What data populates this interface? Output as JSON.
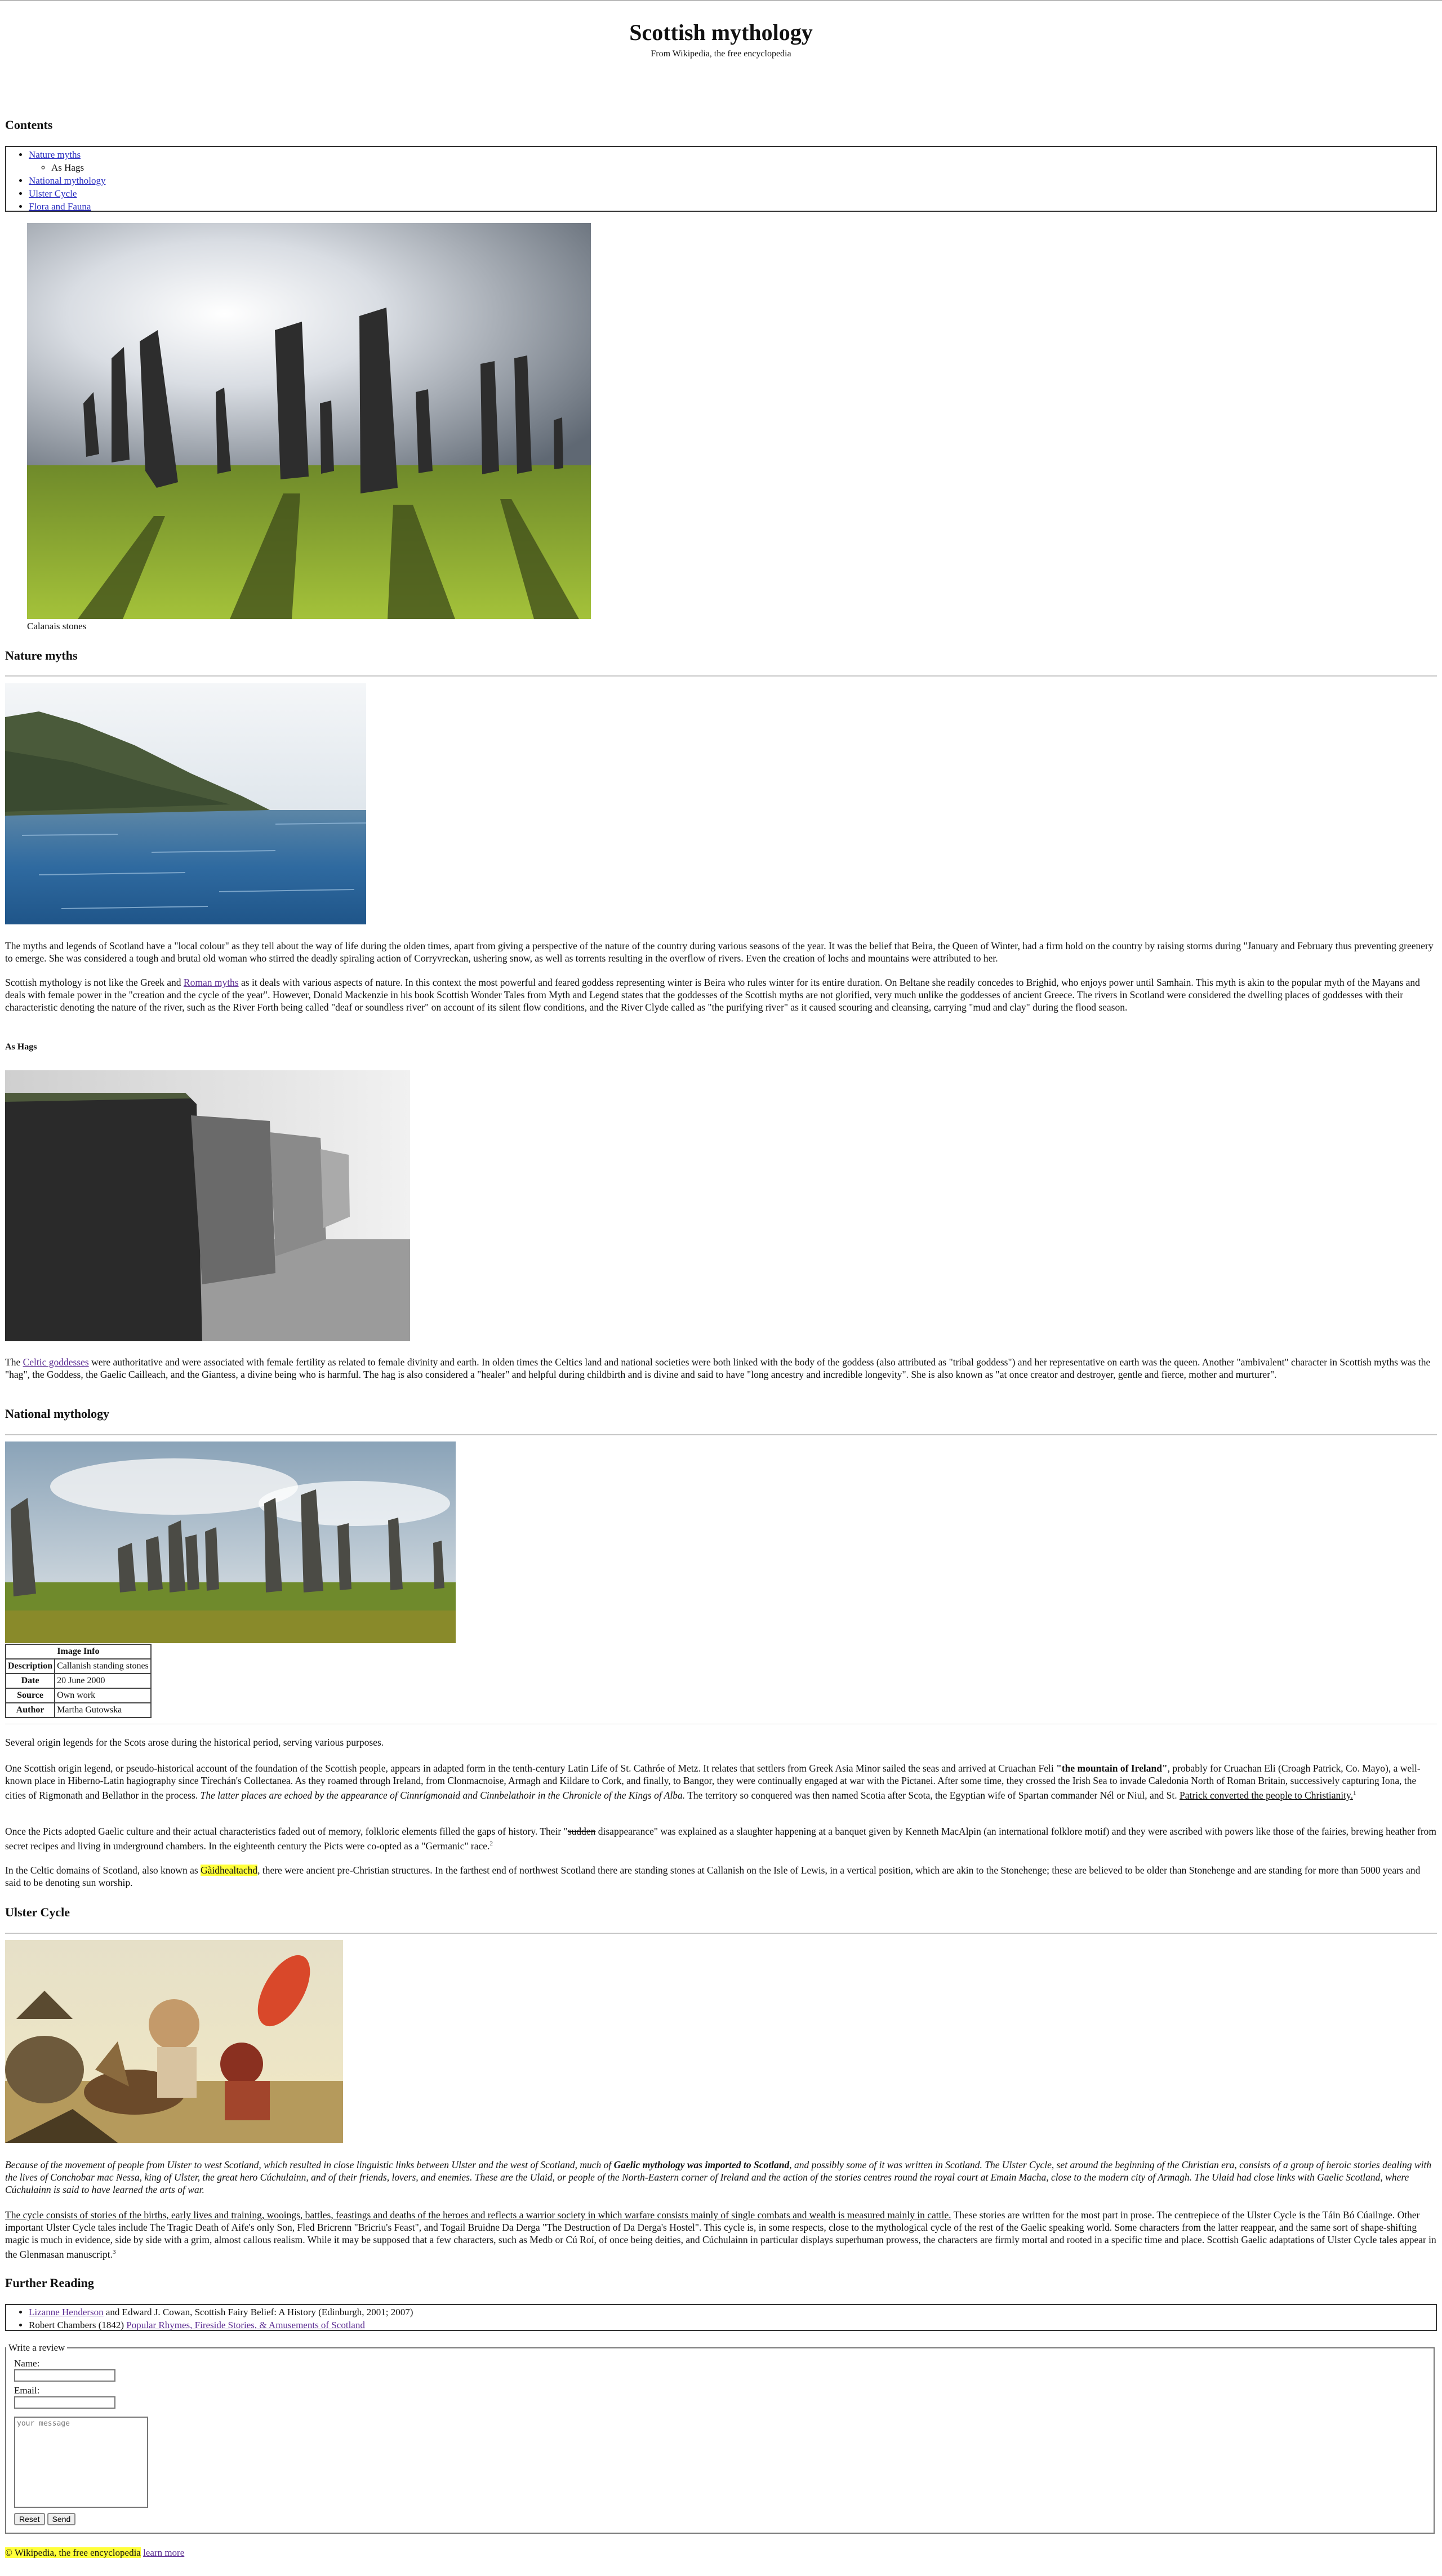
{
  "header": {
    "title": "Scottish mythology",
    "subtitle": "From Wikipedia, the free encyclopedia"
  },
  "contents": {
    "heading": "Contents",
    "items": [
      "Nature myths",
      "As Hags",
      "National mythology",
      "Ulster Cycle",
      "Flora and Fauna"
    ]
  },
  "figure_callanais": {
    "caption": "Calanais stones"
  },
  "nature_myths": {
    "heading": "Nature myths",
    "p1": "The myths and legends of Scotland have a \"local colour\" as they tell about the way of life during the olden times, apart from giving a perspective of the nature of the country during various seasons of the year. It was the belief that Beira, the Queen of Winter, had a firm hold on the country by raising storms during \"January and February thus preventing greenery to emerge. She was considered a tough and brutal old woman who stirred the deadly spiraling action of Corryvreckan, ushering snow, as well as torrents resulting in the overflow of rivers. Even the creation of lochs and mountains were attributed to her.",
    "p2_a": "Scottish mythology is not like the Greek and ",
    "p2_link": "Roman myths",
    "p2_b": " as it deals with various aspects of nature. In this context the most powerful and feared goddess representing winter is Beira who rules winter for its entire duration. On Beltane she readily concedes to Brighid, who enjoys power until Samhain. This myth is akin to the popular myth of the Mayans and deals with female power in the \"creation and the cycle of the year\". However, Donald Mackenzie in his book Scottish Wonder Tales from Myth and Legend states that the goddesses of the Scottish myths are not glorified, very much unlike the goddesses of ancient Greece. The rivers in Scotland were considered the dwelling places of goddesses with their characteristic denoting the nature of the river, such as the River Forth being called \"deaf or soundless river\" on account of its silent flow conditions, and the River Clyde called as \"the purifying river\" as it caused scouring and cleansing, carrying \"mud and clay\" during the flood season."
  },
  "as_hags": {
    "heading": "As Hags",
    "p_a": "The ",
    "p_link": "Celtic goddesses",
    "p_b": " were authoritative and were associated with female fertility as related to female divinity and earth. In olden times the Celtics land and national societies were both linked with the body of the goddess (also attributed as \"tribal goddess\") and her representative on earth was the queen. Another \"ambivalent\" character in Scottish myths was the \"hag\", the Goddess, the Gaelic Cailleach, and the Giantess, a divine being who is harmful. The hag is also considered a \"healer\" and helpful during childbirth and is divine and said to have \"long ancestry and incredible longevity\". She is also known as \"at once creator and destroyer, gentle and fierce, mother and murturer\"."
  },
  "national": {
    "heading": "National mythology",
    "table_caption": "Image Info",
    "rows": [
      {
        "label": "Description",
        "value": "Callanish standing stones"
      },
      {
        "label": "Date",
        "value": "20 June 2000"
      },
      {
        "label": "Source",
        "value": "Own work"
      },
      {
        "label": "Author",
        "value": "Martha Gutowska"
      }
    ],
    "intro": "Several origin legends for the Scots arose during the historical period, serving various purposes.",
    "p1_a": "One Scottish origin legend, or pseudo-historical account of the foundation of the Scottish people, appears in adapted form in the tenth-century Latin Life of St. Cathróe of Metz. It relates that settlers from Greek Asia Minor sailed the seas and arrived at Cruachan Feli ",
    "p1_bold": "\"the mountain of Ireland\"",
    "p1_b": ", probably for Cruachan Eli (Croagh Patrick, Co. Mayo), a well-known place in Hiberno-Latin hagiography since Tírechán's Collectanea. As they roamed through Ireland, from Clonmacnoise, Armagh and Kildare to Cork, and finally, to Bangor, they were continually engaged at war with the Pictanei. After some time, they crossed the Irish Sea to invade Caledonia North of Roman Britain, successively capturing Iona, the cities of Rigmonath and Bellathor in the process. ",
    "p1_italic": "The latter places are echoed by the appearance of Cinnrígmonaid and Cinnbelathoir in the Chronicle of the Kings of Alba.",
    "p1_c": " The territory so conquered was then named Scotia after Scota, the Egyptian wife of Spartan commander Nél or Niul, and St. ",
    "p1_underline": "Patrick converted the people to Christianity.",
    "p1_sup": "1",
    "p2_a": "Once the Picts adopted Gaelic culture and their actual characteristics faded out of memory, folkloric elements filled the gaps of history. Their \"",
    "p2_strike": "sudden",
    "p2_b": " disappearance\" was explained as a slaughter happening at a banquet given by Kenneth MacAlpin (an international folklore motif) and they were ascribed with powers like those of the fairies, brewing heather from secret recipes and living in underground chambers. In the eighteenth century the Picts were co-opted as a \"Germanic\" race.",
    "p2_sup": "2",
    "p3_a": "In the Celtic domains of Scotland, also known as ",
    "p3_hl": "Gàidhealtachd",
    "p3_b": ", there were ancient pre-Christian structures. In the farthest end of northwest Scotland there are standing stones at Callanish on the Isle of Lewis, in a vertical position, which are akin to the Stonehenge; these are believed to be older than Stonehenge and are standing for more than 5000 years and said to be denoting sun worship."
  },
  "ulster": {
    "heading": "Ulster Cycle",
    "p1_a": "Because of the movement of people from Ulster to west Scotland, which resulted in close linguistic links between Ulster and the west of Scotland, much of ",
    "p1_bold": "Gaelic mythology was imported to Scotland",
    "p1_b": ", and possibly some of it was written in Scotland. The Ulster Cycle, set around the beginning of the Christian era, consists of a group of heroic stories dealing with the lives of Conchobar mac Nessa, king of Ulster, the great hero Cúchulainn, and of their friends, lovers, and enemies. These are the Ulaid, or people of the North-Eastern corner of Ireland and the action of the stories centres round the royal court at Emain Macha, close to the modern city of Armagh. The Ulaid had close links with Gaelic Scotland, where Cúchulainn is said to have learned the arts of war.",
    "p2_underline": "The cycle consists of stories of the births, early lives and training, wooings, battles, feastings and deaths of the heroes and reflects a warrior society in which warfare consists mainly of single combats and wealth is measured mainly in cattle.",
    "p2_b": " These stories are written for the most part in prose. The centrepiece of the Ulster Cycle is the Táin Bó Cúailnge. Other important Ulster Cycle tales include The Tragic Death of Aife's only Son, Fled Bricrenn \"Bricriu's Feast\", and Togail Bruidne Da Derga \"The Destruction of Da Derga's Hostel\". This cycle is, in some respects, close to the mythological cycle of the rest of the Gaelic speaking world. Some characters from the latter reappear, and the same sort of shape-shifting magic is much in evidence, side by side with a grim, almost callous realism. While it may be supposed that a few characters, such as Medb or Cú Roí, of once being deities, and Cúchulainn in particular displays superhuman prowess, the characters are firmly mortal and rooted in a specific time and place. Scottish Gaelic adaptations of Ulster Cycle tales appear in the Glenmasan manuscript.",
    "p2_sup": "3"
  },
  "further": {
    "heading": "Further Reading",
    "item1_link": "Lizanne Henderson",
    "item1_rest": " and Edward J. Cowan, Scottish Fairy Belief: A History (Edinburgh, 2001; 2007)",
    "item2_a": "Robert Chambers (1842) ",
    "item2_link": "Popular Rhymes, Fireside Stories, & Amusements of Scotland"
  },
  "review_form": {
    "legend": "Write a review",
    "name_label": "Name:",
    "email_label": "Email:",
    "message_placeholder": "your message",
    "reset_label": "Reset",
    "send_label": "Send"
  },
  "footer": {
    "copyright": "© Wikipedia, the free encyclopedia",
    "link": "learn more"
  },
  "colors": {
    "highlight": "#ffff3a",
    "link": "#2a2ec0",
    "visited_link": "#5b2c92"
  }
}
